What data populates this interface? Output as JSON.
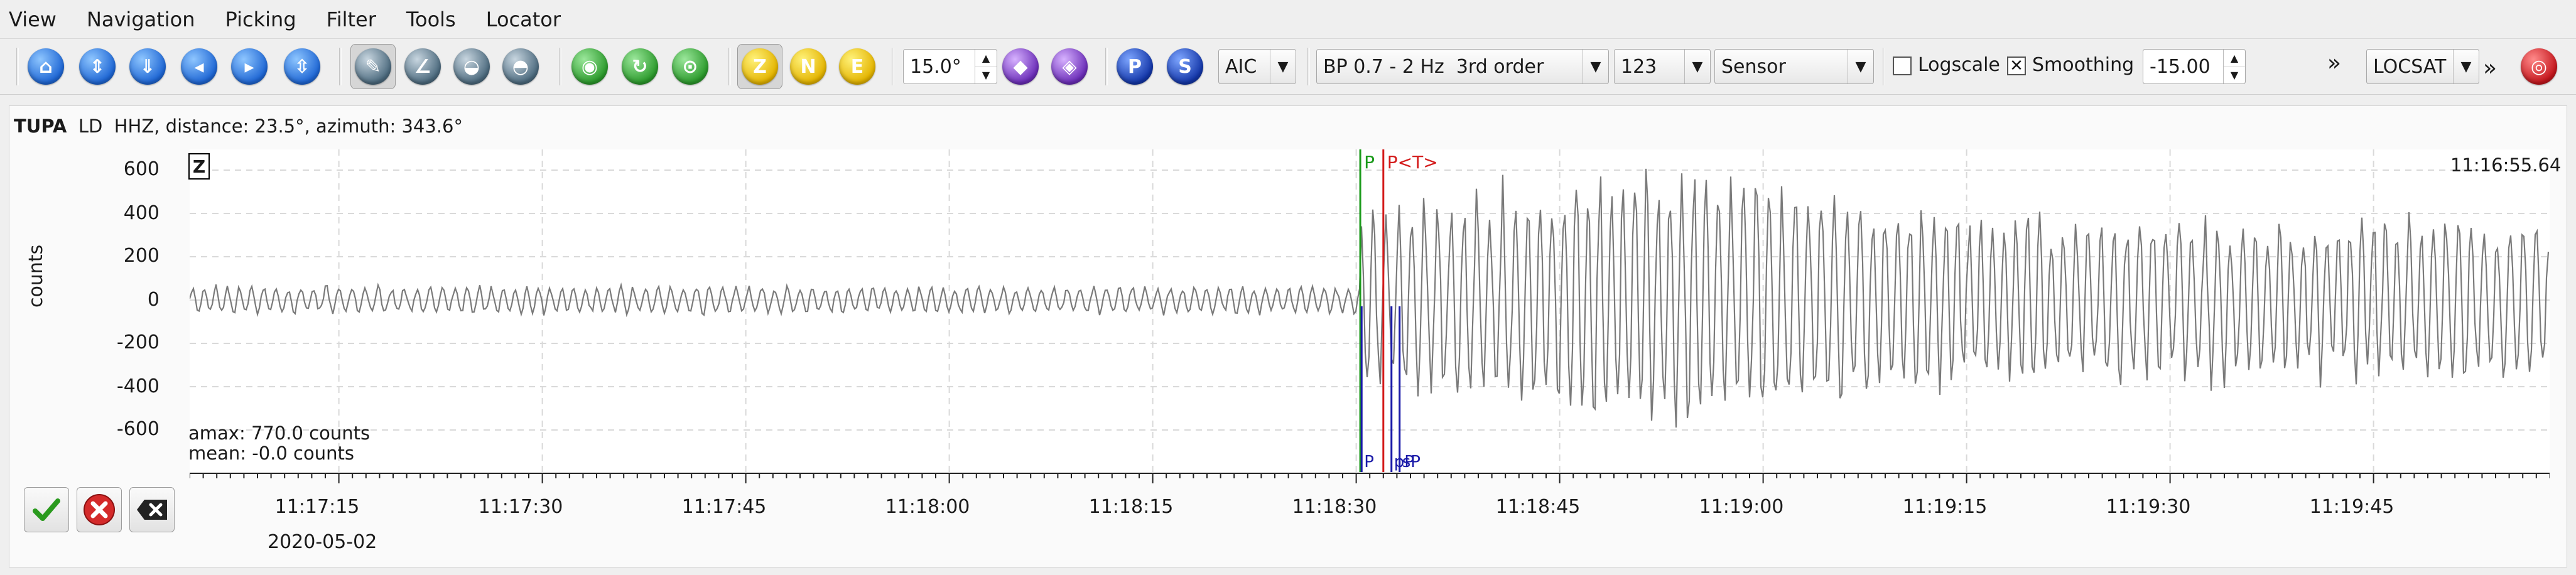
{
  "menu": [
    "View",
    "Navigation",
    "Picking",
    "Filter",
    "Tools",
    "Locator"
  ],
  "toolbar": {
    "components": [
      "Z",
      "N",
      "E"
    ],
    "angle": "15.0°",
    "picker": "AIC",
    "filter": "BP 0.7 - 2 Hz  3rd order",
    "channels": "123",
    "unit": "Sensor",
    "logscale_label": "Logscale",
    "smoothing_label": "Smoothing",
    "offset": "-15.00",
    "locator": "LOCSAT",
    "p_label": "P",
    "s_label": "S"
  },
  "trace": {
    "station": "TUPA",
    "network": "LD",
    "channel": "HHZ, distance: 23.5°, azimuth: 343.6°",
    "component": "Z",
    "ylabel": "counts",
    "yticks": [
      "600",
      "400",
      "200",
      "0",
      "-200",
      "-400",
      "-600"
    ],
    "xticks": [
      "11:17:15",
      "11:17:30",
      "11:17:45",
      "11:18:00",
      "11:18:15",
      "11:18:30",
      "11:18:45",
      "11:19:00",
      "11:19:15",
      "11:19:30",
      "11:19:45"
    ],
    "date": "2020-05-02",
    "amax": "amax: 770.0 counts",
    "mean": "mean: -0.0 counts",
    "time_corner": "11:16:55.64",
    "picks_top": [
      {
        "label": "P",
        "color": "#1a9a1a"
      },
      {
        "label": "P<T>",
        "color": "#d41c1c"
      }
    ],
    "picks_bottom": [
      {
        "label": "P",
        "color": "#1a1aa8"
      },
      {
        "label": "pP",
        "color": "#1a1aa8"
      },
      {
        "label": "sP",
        "color": "#1a1aa8"
      }
    ]
  },
  "chart_data": {
    "type": "line",
    "title": "",
    "xlabel": "",
    "ylabel": "counts",
    "ylim": [
      -770,
      770
    ],
    "xlim": [
      "11:17:04",
      "11:20:02"
    ],
    "series": [
      {
        "values": []
      }
    ],
    "picks": [
      {
        "name": "P",
        "time": "11:18:30.3"
      },
      {
        "name": "P<T>",
        "time": "11:18:32.0"
      }
    ]
  },
  "colors": {
    "trace": "#7a7a7a",
    "grid": "#d9d9d9",
    "p_pick": "#1a9a1a",
    "theo_pick": "#d41c1c",
    "blue_picks": "#1a1aa8"
  },
  "icons": {
    "actions": [
      "accept-icon",
      "reject-icon",
      "delete-icon"
    ]
  }
}
